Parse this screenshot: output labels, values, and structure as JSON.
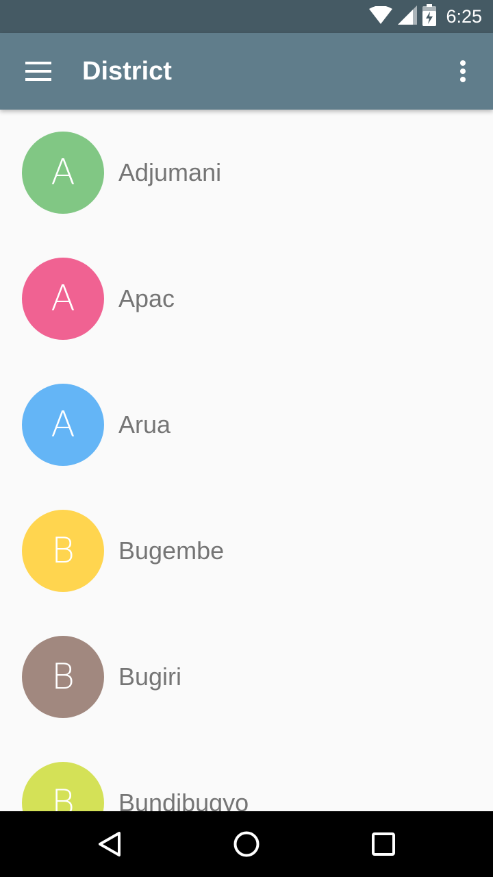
{
  "status_bar": {
    "time": "6:25",
    "icons": [
      "wifi-icon",
      "cell-signal-icon",
      "battery-charging-icon"
    ]
  },
  "app_bar": {
    "title": "District",
    "nav_icon": "hamburger-menu-icon",
    "overflow_icon": "more-vert-icon"
  },
  "districts": [
    {
      "initial": "A",
      "name": "Adjumani",
      "color": "#81c784"
    },
    {
      "initial": "A",
      "name": "Apac",
      "color": "#f06292"
    },
    {
      "initial": "A",
      "name": "Arua",
      "color": "#64b5f6"
    },
    {
      "initial": "B",
      "name": "Bugembe",
      "color": "#ffd54f"
    },
    {
      "initial": "B",
      "name": "Bugiri",
      "color": "#a1887f"
    },
    {
      "initial": "B",
      "name": "Bundibugyo",
      "color": "#d4e157"
    }
  ],
  "nav_bar": {
    "icons": [
      "back-icon",
      "home-icon",
      "recents-icon"
    ]
  },
  "colors": {
    "status_bar": "#455a64",
    "app_bar": "#607d8b",
    "background": "#fafafa",
    "text": "#757575"
  }
}
